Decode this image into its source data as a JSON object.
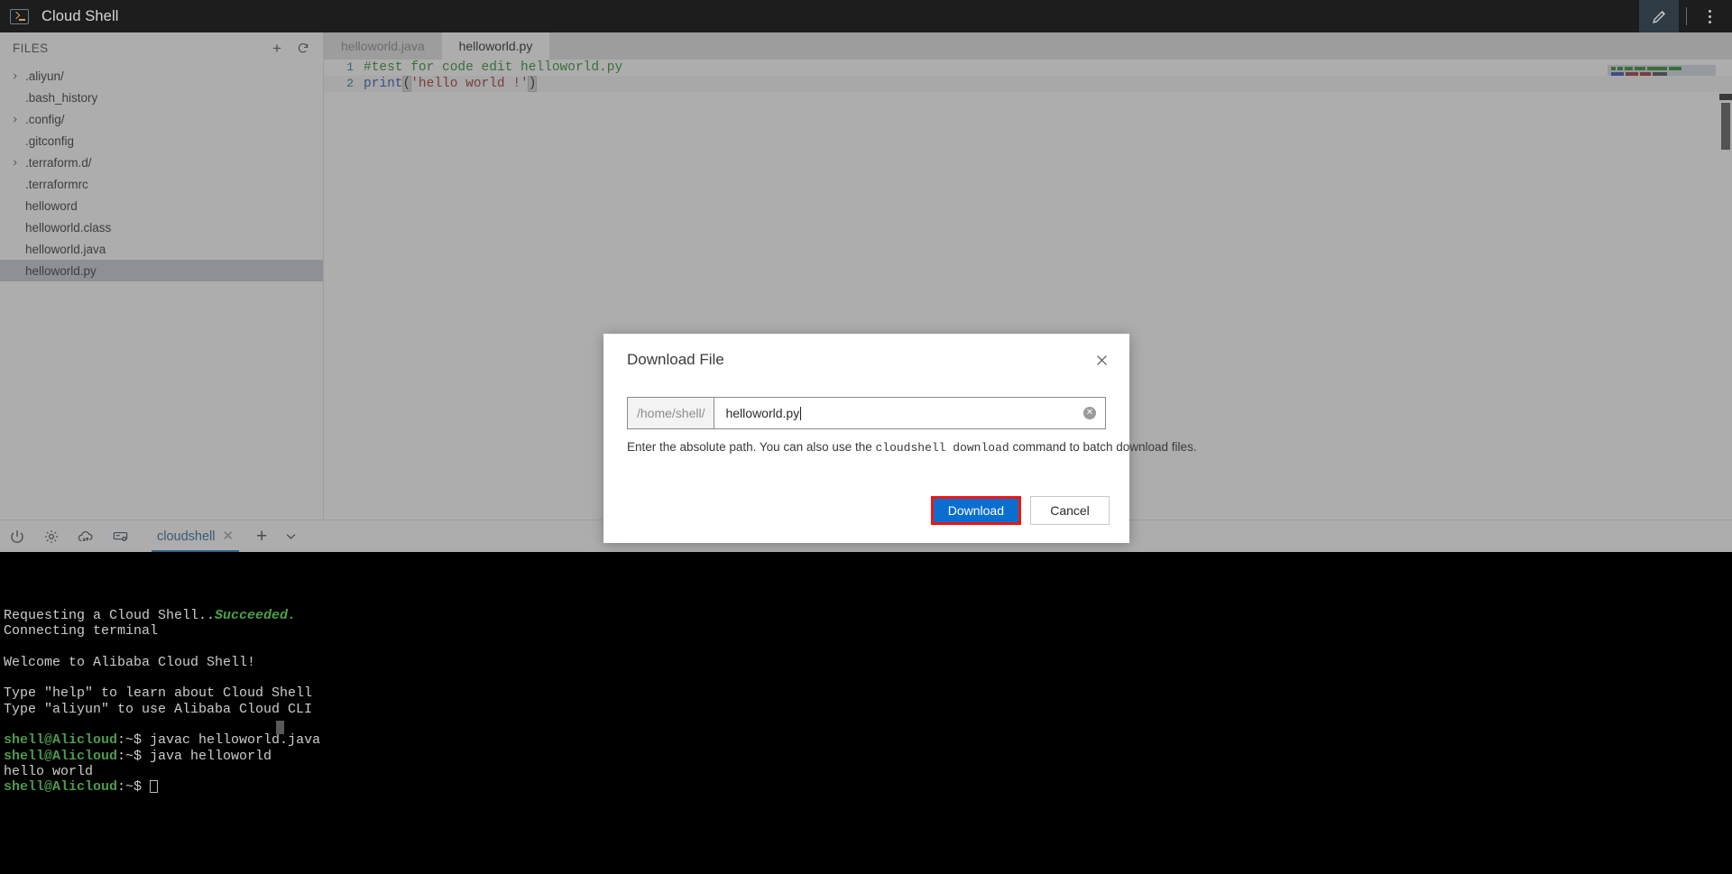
{
  "titlebar": {
    "app_title": "Cloud Shell",
    "logo_icon": "terminal-prompt-icon",
    "edit_icon": "pencil-edit-icon",
    "menu_icon": "kebab-menu-icon"
  },
  "sidebar": {
    "header_label": "FILES",
    "new_file_icon": "plus-icon",
    "refresh_icon": "refresh-icon",
    "items": [
      {
        "name": ".aliyun/",
        "expandable": true,
        "selected": false
      },
      {
        "name": ".bash_history",
        "expandable": false,
        "selected": false
      },
      {
        "name": ".config/",
        "expandable": true,
        "selected": false
      },
      {
        "name": ".gitconfig",
        "expandable": false,
        "selected": false
      },
      {
        "name": ".terraform.d/",
        "expandable": true,
        "selected": false
      },
      {
        "name": ".terraformrc",
        "expandable": false,
        "selected": false
      },
      {
        "name": "helloword",
        "expandable": false,
        "selected": false
      },
      {
        "name": "helloworld.class",
        "expandable": false,
        "selected": false
      },
      {
        "name": "helloworld.java",
        "expandable": false,
        "selected": false
      },
      {
        "name": "helloworld.py",
        "expandable": false,
        "selected": true
      }
    ]
  },
  "editor": {
    "tabs": [
      {
        "label": "helloworld.java",
        "active": false
      },
      {
        "label": "helloworld.py",
        "active": true
      }
    ],
    "lines": [
      {
        "number": "1",
        "text": "#test for code edit helloworld.py"
      },
      {
        "number": "2",
        "text": "print('hello world !')"
      }
    ],
    "line1_comment": "#test for code edit helloworld.py",
    "line2_fn": "print",
    "line2_open_paren": "(",
    "line2_string": "'hello world !'",
    "line2_close_paren": ")"
  },
  "terminal_toolbar": {
    "power_icon": "power-icon",
    "settings_icon": "gear-icon",
    "upload_download_icon": "cloud-upload-download-icon",
    "storage_icon": "server-settings-icon",
    "tab_label": "cloudshell",
    "tab_close_icon": "close-icon",
    "add_tab_icon": "plus-icon",
    "tab_menu_icon": "chevron-down-icon"
  },
  "terminal": {
    "lines": [
      {
        "segments": [
          {
            "text": "Requesting a Cloud Shell..",
            "style": "white"
          },
          {
            "text": "Succeeded.",
            "style": "green-bold"
          }
        ]
      },
      {
        "segments": [
          {
            "text": "Connecting terminal",
            "style": "white"
          }
        ]
      },
      {
        "segments": []
      },
      {
        "segments": [
          {
            "text": "Welcome to Alibaba Cloud Shell!",
            "style": "white"
          }
        ]
      },
      {
        "segments": []
      },
      {
        "segments": [
          {
            "text": "Type \"help\" to learn about Cloud Shell",
            "style": "white"
          }
        ]
      },
      {
        "segments": [
          {
            "text": "Type \"aliyun\" to use Alibaba Cloud CLI",
            "style": "white"
          }
        ]
      },
      {
        "segments": []
      },
      {
        "segments": [
          {
            "text": "shell@Alicloud",
            "style": "prompt"
          },
          {
            "text": ":~$ javac helloworld.java",
            "style": "white"
          }
        ]
      },
      {
        "segments": [
          {
            "text": "shell@Alicloud",
            "style": "prompt"
          },
          {
            "text": ":~$ java helloworld",
            "style": "white"
          }
        ]
      },
      {
        "segments": [
          {
            "text": "hello world",
            "style": "white"
          }
        ]
      },
      {
        "segments": [
          {
            "text": "shell@Alicloud",
            "style": "prompt"
          },
          {
            "text": ":~$ ",
            "style": "white"
          },
          {
            "text": "",
            "style": "cursor"
          }
        ]
      }
    ]
  },
  "modal": {
    "title": "Download File",
    "close_icon": "close-icon",
    "path_prefix": "/home/shell/",
    "path_value": "helloworld.py",
    "clear_icon": "clear-circle-icon",
    "hint_part1": "Enter the absolute path. You can also use the ",
    "hint_mono": "cloudshell download",
    "hint_part2": " command to batch download files.",
    "download_label": "Download",
    "cancel_label": "Cancel",
    "primary_color": "#0a6ed1",
    "highlight_color": "#f01414"
  }
}
